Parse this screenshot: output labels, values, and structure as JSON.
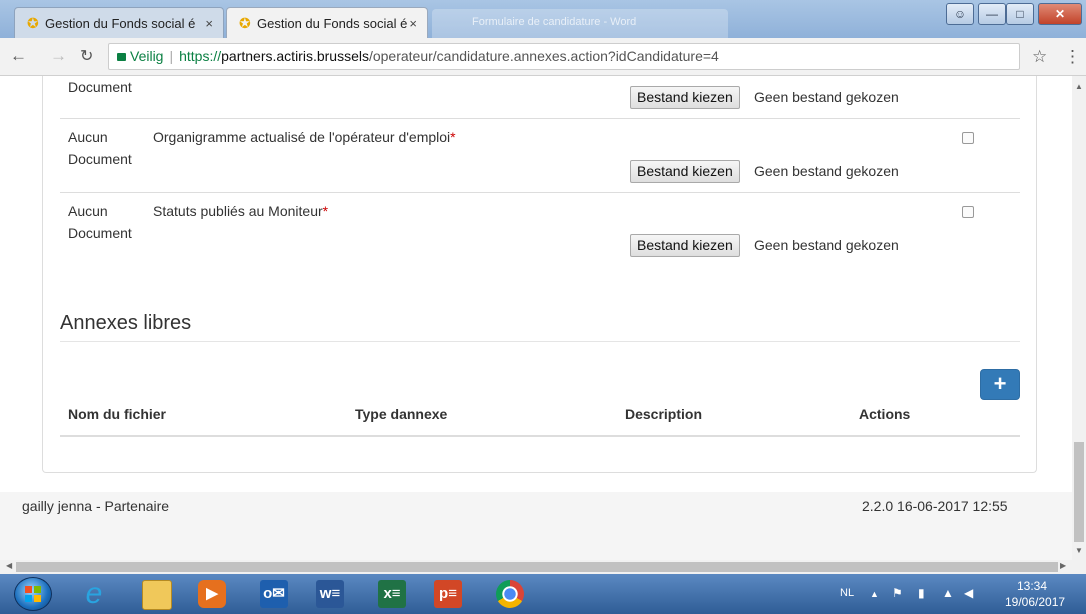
{
  "browser": {
    "tabs": [
      {
        "title": "Gestion du Fonds social é",
        "close": "×"
      },
      {
        "title": "Gestion du Fonds social é",
        "close": "×"
      }
    ],
    "background_window_title": "Formulaire de candidature - Word",
    "secure_label": "Veilig",
    "url_scheme": "https://",
    "url_host": "partners.actiris.brussels",
    "url_path": "/operateur/candidature.annexes.action?idCandidature=4"
  },
  "documents": [
    {
      "status": "Document",
      "title": "",
      "required": false,
      "button": "Bestand kiezen",
      "file": "Geen bestand gekozen",
      "partial": true
    },
    {
      "status": "Aucun Document",
      "title": "Organigramme actualisé de l'opérateur d'emploi",
      "required": true,
      "button": "Bestand kiezen",
      "file": "Geen bestand gekozen"
    },
    {
      "status": "Aucun Document",
      "title": "Statuts publiés au Moniteur",
      "required": true,
      "button": "Bestand kiezen",
      "file": "Geen bestand gekozen"
    }
  ],
  "required_marker": "*",
  "annexes": {
    "title": "Annexes libres",
    "add_label": "+",
    "columns": [
      "Nom du fichier",
      "Type dannexe",
      "Description",
      "Actions"
    ]
  },
  "footer": {
    "user": "gailly jenna - Partenaire",
    "version": "2.2.0 16-06-2017 12:55"
  },
  "taskbar": {
    "apps": [
      "internet-explorer",
      "file-explorer",
      "media-player",
      "outlook",
      "word",
      "excel",
      "powerpoint",
      "chrome"
    ],
    "app_glyphs": {
      "ie": "e",
      "outlook": "o✉",
      "word": "w≡",
      "excel": "x≡",
      "ppt": "p≡"
    },
    "language": "NL",
    "time": "13:34",
    "date": "19/06/2017"
  },
  "colors": {
    "accent": "#337ab7",
    "required": "#cc0000",
    "secure": "#0b8043"
  }
}
